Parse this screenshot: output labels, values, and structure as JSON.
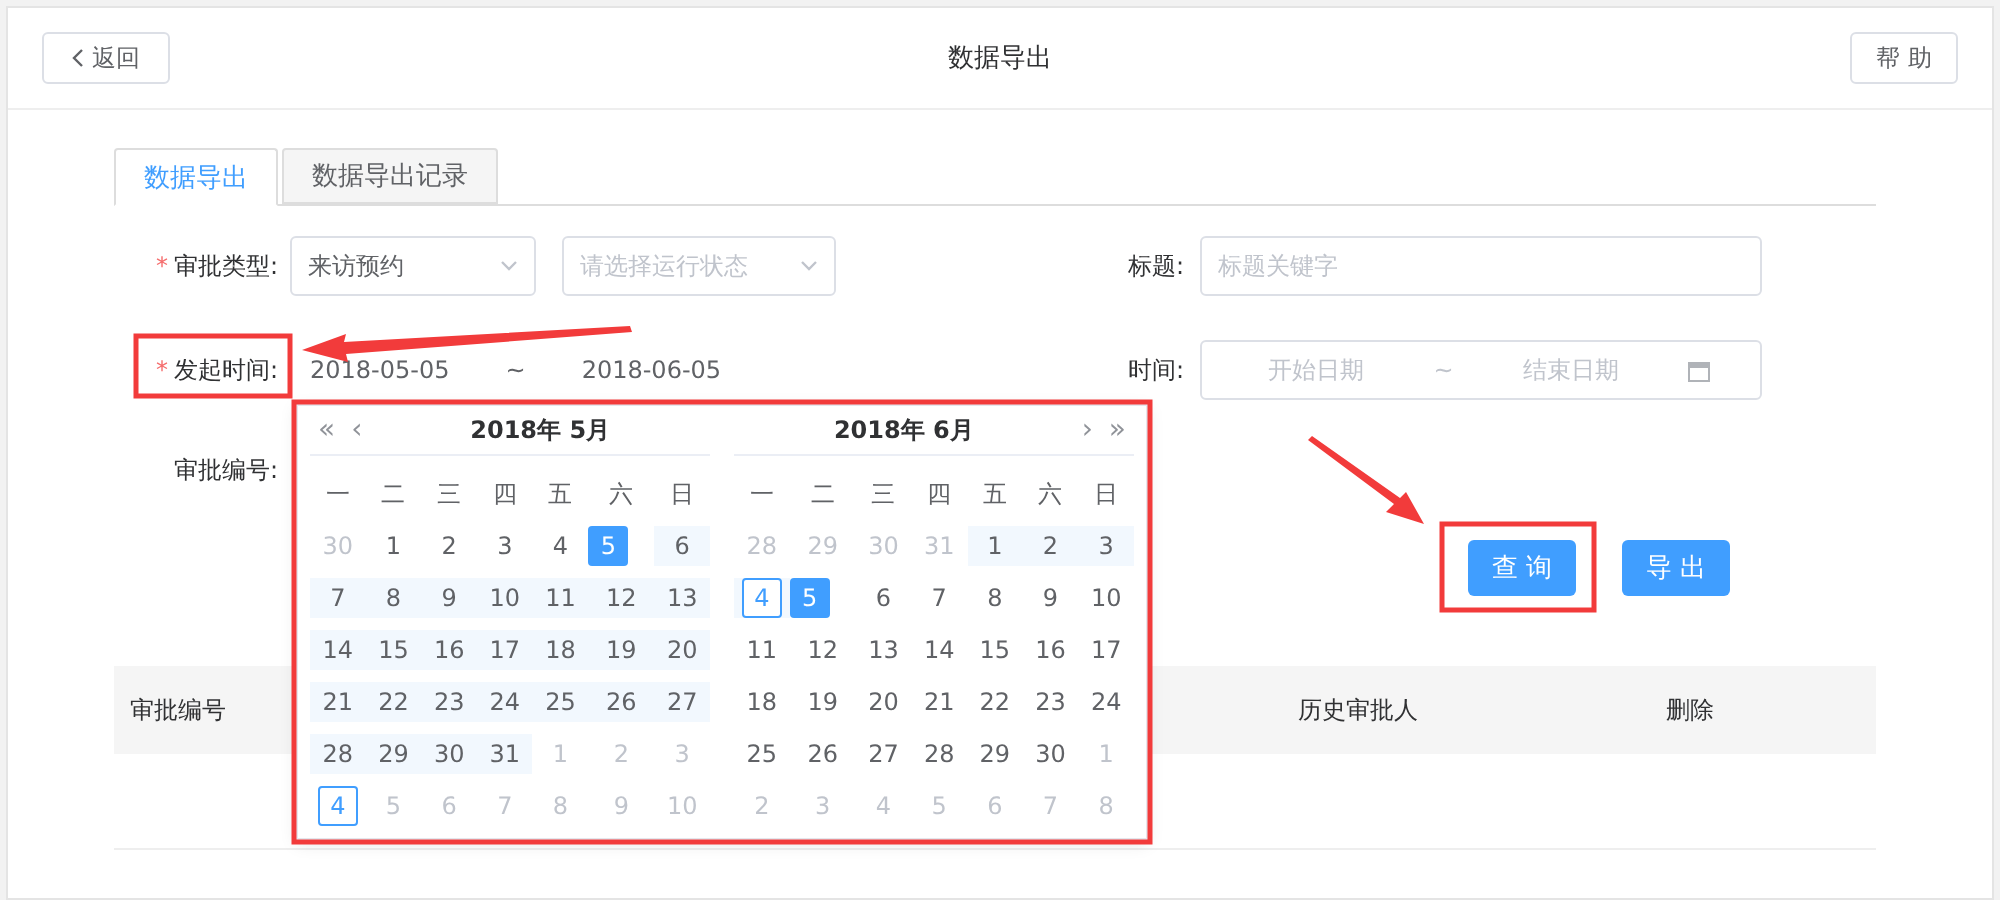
{
  "header": {
    "back": "返回",
    "title": "数据导出",
    "help": "帮 助"
  },
  "tabs": [
    {
      "label": "数据导出",
      "selected": true
    },
    {
      "label": "数据导出记录",
      "selected": false
    }
  ],
  "form": {
    "approval_type": {
      "required_mark": "*",
      "label": "审批类型:",
      "value": "来访预约",
      "status_placeholder": "请选择运行状态"
    },
    "title": {
      "label": "标题:",
      "placeholder": "标题关键字"
    },
    "start_time": {
      "required_mark": "*",
      "label": "发起时间:",
      "start": "2018-05-05",
      "separator": "~",
      "end": "2018-06-05"
    },
    "time": {
      "label": "时间:",
      "start_placeholder": "开始日期",
      "separator": "~",
      "end_placeholder": "结束日期"
    },
    "approval_no": {
      "label": "审批编号:"
    }
  },
  "buttons": [
    "查 询",
    "导 出"
  ],
  "table": {
    "columns": [
      "审批编号",
      "历史审批人",
      "删除"
    ]
  },
  "calendar": {
    "nav": {
      "prev_year": "«",
      "prev_month": "‹",
      "next_month": "›",
      "next_year": "»"
    },
    "months": [
      {
        "title": "2018年 5月",
        "weekdays": [
          "一",
          "二",
          "三",
          "四",
          "五",
          "六",
          "日"
        ],
        "weeks": [
          [
            {
              "text": "30",
              "kind": "other",
              "selected": false,
              "in_range": false,
              "today": false
            },
            {
              "text": "1",
              "kind": "cur",
              "selected": false,
              "in_range": false,
              "today": false
            },
            {
              "text": "2",
              "kind": "cur",
              "selected": false,
              "in_range": false,
              "today": false
            },
            {
              "text": "3",
              "kind": "cur",
              "selected": false,
              "in_range": false,
              "today": false
            },
            {
              "text": "4",
              "kind": "cur",
              "selected": false,
              "in_range": false,
              "today": false
            },
            {
              "text": "5",
              "kind": "cur",
              "selected": true,
              "in_range": false,
              "today": false
            },
            {
              "text": "6",
              "kind": "cur",
              "selected": false,
              "in_range": true,
              "today": false
            }
          ],
          [
            {
              "text": "7",
              "kind": "cur",
              "selected": false,
              "in_range": true,
              "today": false
            },
            {
              "text": "8",
              "kind": "cur",
              "selected": false,
              "in_range": true,
              "today": false
            },
            {
              "text": "9",
              "kind": "cur",
              "selected": false,
              "in_range": true,
              "today": false
            },
            {
              "text": "10",
              "kind": "cur",
              "selected": false,
              "in_range": true,
              "today": false
            },
            {
              "text": "11",
              "kind": "cur",
              "selected": false,
              "in_range": true,
              "today": false
            },
            {
              "text": "12",
              "kind": "cur",
              "selected": false,
              "in_range": true,
              "today": false
            },
            {
              "text": "13",
              "kind": "cur",
              "selected": false,
              "in_range": true,
              "today": false
            }
          ],
          [
            {
              "text": "14",
              "kind": "cur",
              "selected": false,
              "in_range": true,
              "today": false
            },
            {
              "text": "15",
              "kind": "cur",
              "selected": false,
              "in_range": true,
              "today": false
            },
            {
              "text": "16",
              "kind": "cur",
              "selected": false,
              "in_range": true,
              "today": false
            },
            {
              "text": "17",
              "kind": "cur",
              "selected": false,
              "in_range": true,
              "today": false
            },
            {
              "text": "18",
              "kind": "cur",
              "selected": false,
              "in_range": true,
              "today": false
            },
            {
              "text": "19",
              "kind": "cur",
              "selected": false,
              "in_range": true,
              "today": false
            },
            {
              "text": "20",
              "kind": "cur",
              "selected": false,
              "in_range": true,
              "today": false
            }
          ],
          [
            {
              "text": "21",
              "kind": "cur",
              "selected": false,
              "in_range": true,
              "today": false
            },
            {
              "text": "22",
              "kind": "cur",
              "selected": false,
              "in_range": true,
              "today": false
            },
            {
              "text": "23",
              "kind": "cur",
              "selected": false,
              "in_range": true,
              "today": false
            },
            {
              "text": "24",
              "kind": "cur",
              "selected": false,
              "in_range": true,
              "today": false
            },
            {
              "text": "25",
              "kind": "cur",
              "selected": false,
              "in_range": true,
              "today": false
            },
            {
              "text": "26",
              "kind": "cur",
              "selected": false,
              "in_range": true,
              "today": false
            },
            {
              "text": "27",
              "kind": "cur",
              "selected": false,
              "in_range": true,
              "today": false
            }
          ],
          [
            {
              "text": "28",
              "kind": "cur",
              "selected": false,
              "in_range": true,
              "today": false
            },
            {
              "text": "29",
              "kind": "cur",
              "selected": false,
              "in_range": true,
              "today": false
            },
            {
              "text": "30",
              "kind": "cur",
              "selected": false,
              "in_range": true,
              "today": false
            },
            {
              "text": "31",
              "kind": "cur",
              "selected": false,
              "in_range": true,
              "today": false
            },
            {
              "text": "1",
              "kind": "other",
              "selected": false,
              "in_range": false,
              "today": false
            },
            {
              "text": "2",
              "kind": "other",
              "selected": false,
              "in_range": false,
              "today": false
            },
            {
              "text": "3",
              "kind": "other",
              "selected": false,
              "in_range": false,
              "today": false
            }
          ],
          [
            {
              "text": "4",
              "kind": "other",
              "selected": false,
              "in_range": false,
              "today": true
            },
            {
              "text": "5",
              "kind": "other",
              "selected": false,
              "in_range": false,
              "today": false
            },
            {
              "text": "6",
              "kind": "other",
              "selected": false,
              "in_range": false,
              "today": false
            },
            {
              "text": "7",
              "kind": "other",
              "selected": false,
              "in_range": false,
              "today": false
            },
            {
              "text": "8",
              "kind": "other",
              "selected": false,
              "in_range": false,
              "today": false
            },
            {
              "text": "9",
              "kind": "other",
              "selected": false,
              "in_range": false,
              "today": false
            },
            {
              "text": "10",
              "kind": "other",
              "selected": false,
              "in_range": false,
              "today": false
            }
          ]
        ]
      },
      {
        "title": "2018年 6月",
        "weekdays": [
          "一",
          "二",
          "三",
          "四",
          "五",
          "六",
          "日"
        ],
        "weeks": [
          [
            {
              "text": "28",
              "kind": "other",
              "selected": false,
              "in_range": false,
              "today": false
            },
            {
              "text": "29",
              "kind": "other",
              "selected": false,
              "in_range": false,
              "today": false
            },
            {
              "text": "30",
              "kind": "other",
              "selected": false,
              "in_range": false,
              "today": false
            },
            {
              "text": "31",
              "kind": "other",
              "selected": false,
              "in_range": false,
              "today": false
            },
            {
              "text": "1",
              "kind": "cur",
              "selected": false,
              "in_range": true,
              "today": false
            },
            {
              "text": "2",
              "kind": "cur",
              "selected": false,
              "in_range": true,
              "today": false
            },
            {
              "text": "3",
              "kind": "cur",
              "selected": false,
              "in_range": true,
              "today": false
            }
          ],
          [
            {
              "text": "4",
              "kind": "cur",
              "selected": false,
              "in_range": true,
              "today": true
            },
            {
              "text": "5",
              "kind": "cur",
              "selected": true,
              "in_range": false,
              "today": false
            },
            {
              "text": "6",
              "kind": "cur",
              "selected": false,
              "in_range": false,
              "today": false
            },
            {
              "text": "7",
              "kind": "cur",
              "selected": false,
              "in_range": false,
              "today": false
            },
            {
              "text": "8",
              "kind": "cur",
              "selected": false,
              "in_range": false,
              "today": false
            },
            {
              "text": "9",
              "kind": "cur",
              "selected": false,
              "in_range": false,
              "today": false
            },
            {
              "text": "10",
              "kind": "cur",
              "selected": false,
              "in_range": false,
              "today": false
            }
          ],
          [
            {
              "text": "11",
              "kind": "cur",
              "selected": false,
              "in_range": false,
              "today": false
            },
            {
              "text": "12",
              "kind": "cur",
              "selected": false,
              "in_range": false,
              "today": false
            },
            {
              "text": "13",
              "kind": "cur",
              "selected": false,
              "in_range": false,
              "today": false
            },
            {
              "text": "14",
              "kind": "cur",
              "selected": false,
              "in_range": false,
              "today": false
            },
            {
              "text": "15",
              "kind": "cur",
              "selected": false,
              "in_range": false,
              "today": false
            },
            {
              "text": "16",
              "kind": "cur",
              "selected": false,
              "in_range": false,
              "today": false
            },
            {
              "text": "17",
              "kind": "cur",
              "selected": false,
              "in_range": false,
              "today": false
            }
          ],
          [
            {
              "text": "18",
              "kind": "cur",
              "selected": false,
              "in_range": false,
              "today": false
            },
            {
              "text": "19",
              "kind": "cur",
              "selected": false,
              "in_range": false,
              "today": false
            },
            {
              "text": "20",
              "kind": "cur",
              "selected": false,
              "in_range": false,
              "today": false
            },
            {
              "text": "21",
              "kind": "cur",
              "selected": false,
              "in_range": false,
              "today": false
            },
            {
              "text": "22",
              "kind": "cur",
              "selected": false,
              "in_range": false,
              "today": false
            },
            {
              "text": "23",
              "kind": "cur",
              "selected": false,
              "in_range": false,
              "today": false
            },
            {
              "text": "24",
              "kind": "cur",
              "selected": false,
              "in_range": false,
              "today": false
            }
          ],
          [
            {
              "text": "25",
              "kind": "cur",
              "selected": false,
              "in_range": false,
              "today": false
            },
            {
              "text": "26",
              "kind": "cur",
              "selected": false,
              "in_range": false,
              "today": false
            },
            {
              "text": "27",
              "kind": "cur",
              "selected": false,
              "in_range": false,
              "today": false
            },
            {
              "text": "28",
              "kind": "cur",
              "selected": false,
              "in_range": false,
              "today": false
            },
            {
              "text": "29",
              "kind": "cur",
              "selected": false,
              "in_range": false,
              "today": false
            },
            {
              "text": "30",
              "kind": "cur",
              "selected": false,
              "in_range": false,
              "today": false
            },
            {
              "text": "1",
              "kind": "other",
              "selected": false,
              "in_range": false,
              "today": false
            }
          ],
          [
            {
              "text": "2",
              "kind": "other",
              "selected": false,
              "in_range": false,
              "today": false
            },
            {
              "text": "3",
              "kind": "other",
              "selected": false,
              "in_range": false,
              "today": false
            },
            {
              "text": "4",
              "kind": "other",
              "selected": false,
              "in_range": false,
              "today": false
            },
            {
              "text": "5",
              "kind": "other",
              "selected": false,
              "in_range": false,
              "today": false
            },
            {
              "text": "6",
              "kind": "other",
              "selected": false,
              "in_range": false,
              "today": false
            },
            {
              "text": "7",
              "kind": "other",
              "selected": false,
              "in_range": false,
              "today": false
            },
            {
              "text": "8",
              "kind": "other",
              "selected": false,
              "in_range": false,
              "today": false
            }
          ]
        ]
      }
    ]
  }
}
